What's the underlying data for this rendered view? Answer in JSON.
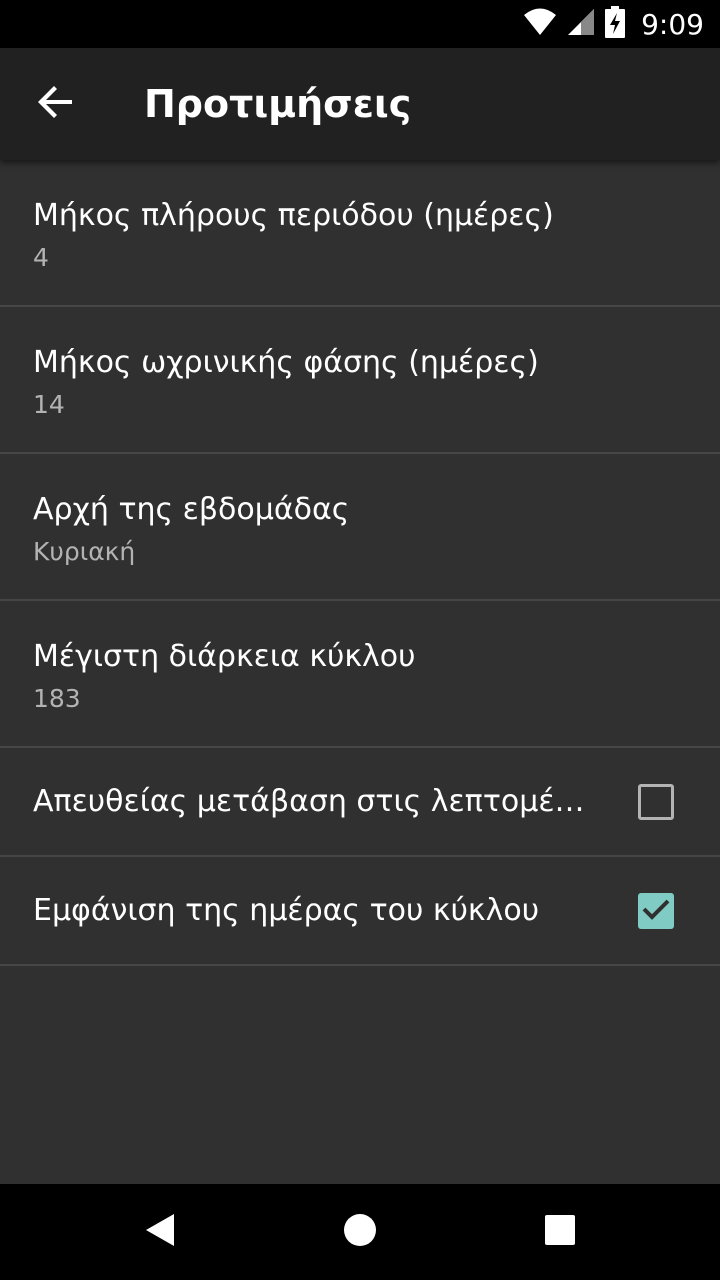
{
  "status_bar": {
    "time": "9:09",
    "icons": [
      "wifi-icon",
      "cell-signal-icon",
      "battery-charging-icon"
    ]
  },
  "app_bar": {
    "back_icon": "arrow-back-icon",
    "title": "Προτιμήσεις"
  },
  "preferences": [
    {
      "title": "Μήκος πλήρους περιόδου (ημέρες)",
      "summary": "4"
    },
    {
      "title": "Μήκος ωχρινικής φάσης (ημέρες)",
      "summary": "14"
    },
    {
      "title": "Αρχή της εβδομάδας",
      "summary": "Κυριακή"
    },
    {
      "title": "Μέγιστη διάρκεια κύκλου",
      "summary": "183"
    }
  ],
  "checkbox_preferences": [
    {
      "title": "Απευθείας μετάβαση στις λεπτομέρε..",
      "checked": false
    },
    {
      "title": "Εμφάνιση της ημέρας του κύκλου",
      "checked": true
    }
  ],
  "colors": {
    "background": "#303030",
    "app_bar": "#212121",
    "accent": "#80cbc4",
    "divider": "#464646"
  },
  "nav_bar": {
    "icons": [
      "back-triangle-icon",
      "home-circle-icon",
      "recents-square-icon"
    ]
  }
}
